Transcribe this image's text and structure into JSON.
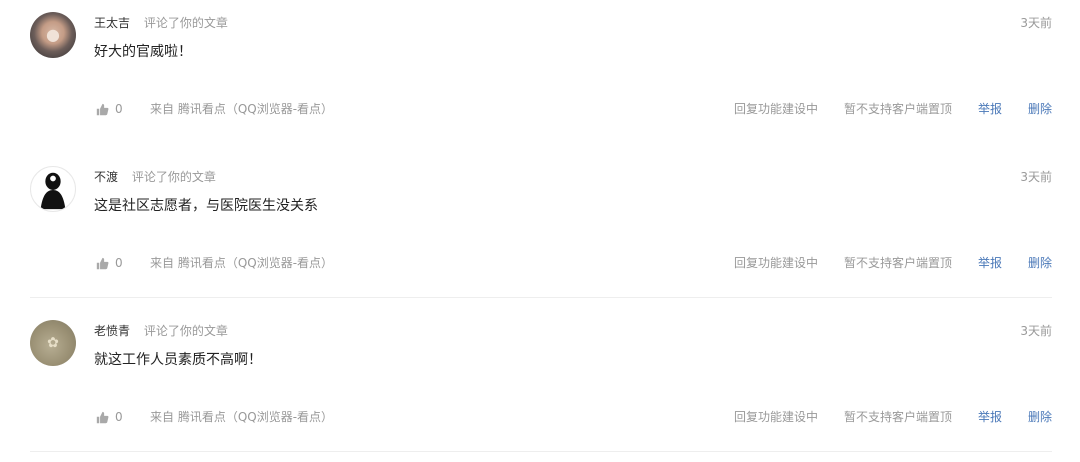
{
  "comments": [
    {
      "user": "王太吉",
      "action": "评论了你的文章",
      "time": "3天前",
      "content": "好大的官威啦！",
      "likes": "0",
      "source": "来自 腾讯看点（QQ浏览器-看点）",
      "reply_label": "回复功能建设中",
      "pin_label": "暂不支持客户端置顶",
      "report_label": "举报",
      "delete_label": "删除"
    },
    {
      "user": "不渡",
      "action": "评论了你的文章",
      "time": "3天前",
      "content": "这是社区志愿者，与医院医生没关系",
      "likes": "0",
      "source": "来自 腾讯看点（QQ浏览器-看点）",
      "reply_label": "回复功能建设中",
      "pin_label": "暂不支持客户端置顶",
      "report_label": "举报",
      "delete_label": "删除"
    },
    {
      "user": "老愤青",
      "action": "评论了你的文章",
      "time": "3天前",
      "content": "就这工作人员素质不高啊！",
      "likes": "0",
      "source": "来自 腾讯看点（QQ浏览器-看点）",
      "reply_label": "回复功能建设中",
      "pin_label": "暂不支持客户端置顶",
      "report_label": "举报",
      "delete_label": "删除"
    }
  ],
  "icons": {
    "like": "thumbs-up-icon",
    "avatar": "avatar"
  },
  "colors": {
    "link": "#4a78b8",
    "muted": "#999999",
    "text": "#222222"
  }
}
